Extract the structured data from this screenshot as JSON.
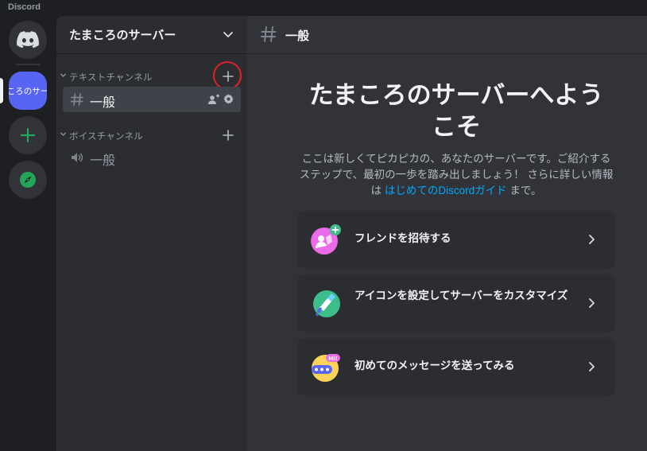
{
  "window": {
    "title": "Discord"
  },
  "rail": {
    "active_server_label": "ころのサー"
  },
  "sidebar": {
    "guild_name": "たまころのサーバー",
    "categories": [
      {
        "label": "テキストチャンネル",
        "channels": [
          {
            "name": "一般",
            "type": "text",
            "selected": true
          }
        ]
      },
      {
        "label": "ボイスチャンネル",
        "channels": [
          {
            "name": "一般",
            "type": "voice",
            "selected": false
          }
        ]
      }
    ],
    "highlight_color": "#e2222a"
  },
  "main": {
    "channel_name": "一般",
    "welcome_title": "たまころのサーバーへようこそ",
    "welcome_desc_before": "ここは新しくてピカピカの、あなたのサーバーです。ご紹介するステップで、最初の一歩を踏み出しましょう！ さらに詳しい情報は ",
    "welcome_link": "はじめてのDiscordガイド",
    "welcome_desc_after": " まで。",
    "cards": [
      {
        "label": "フレンドを招待する",
        "icon": "invite-friends-icon"
      },
      {
        "label": "アイコンを設定してサーバーをカスタマイズ",
        "icon": "customize-icon"
      },
      {
        "label": "初めてのメッセージを送ってみる",
        "icon": "first-message-icon",
        "badge": "Hi!"
      }
    ]
  },
  "colors": {
    "accent": "#5865f2",
    "link": "#00a8fc",
    "green": "#23a55a",
    "bg_main": "#313338",
    "bg_sidebar": "#2b2d31",
    "bg_rail": "#1e1f22"
  }
}
